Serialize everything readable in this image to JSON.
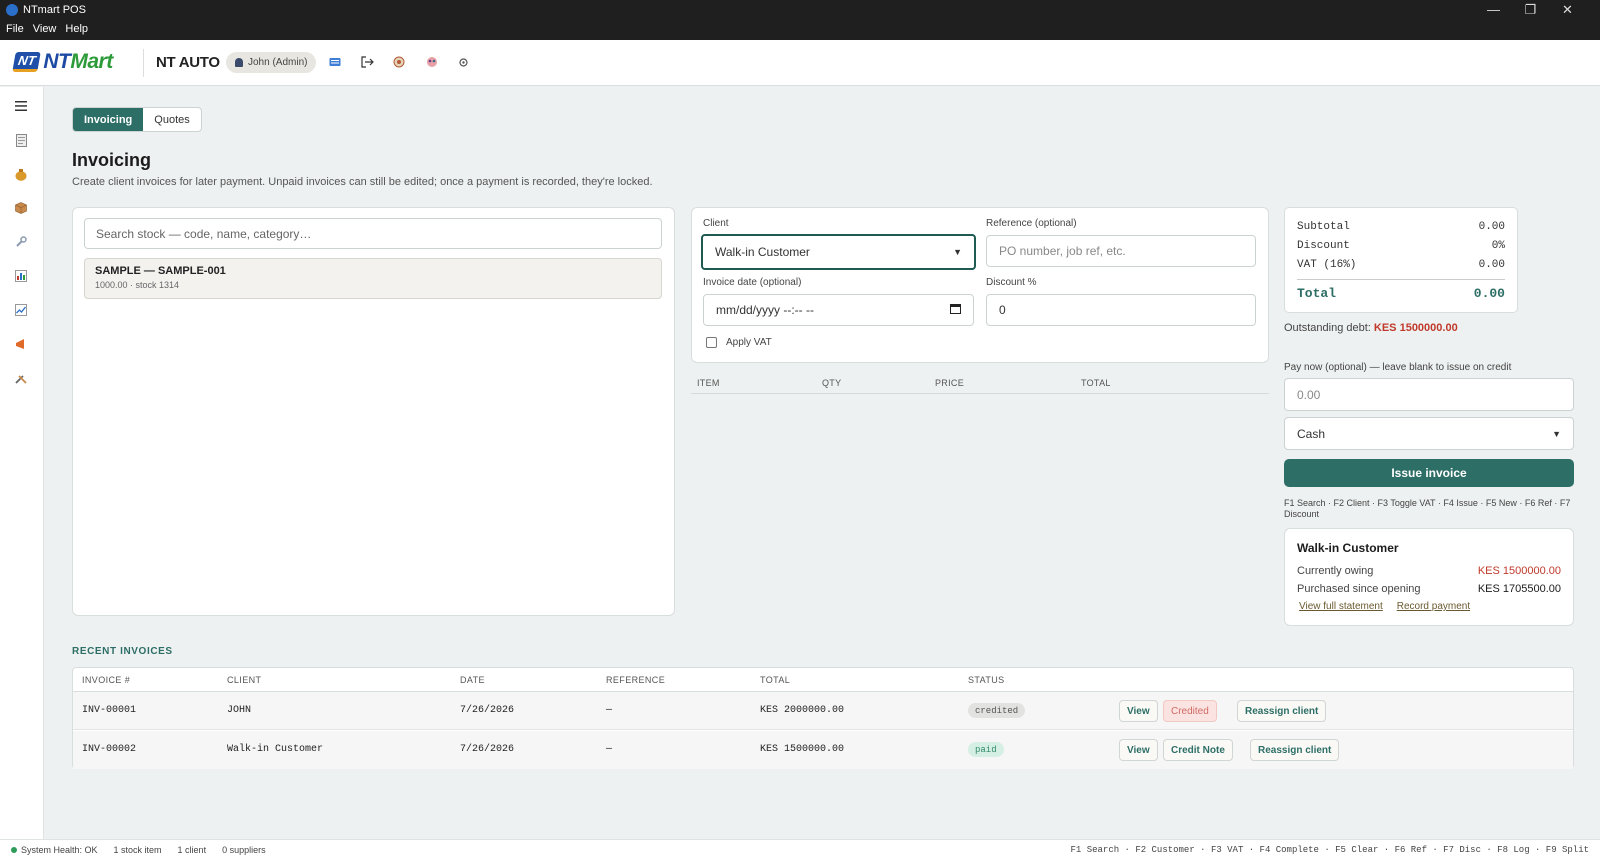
{
  "window": {
    "title": "NTmart POS",
    "menu": [
      "File",
      "View",
      "Help"
    ],
    "controls": [
      "—",
      "❐",
      "✕"
    ]
  },
  "topbar": {
    "logo_mark": "NT",
    "logo_word_a": "NT",
    "logo_word_b": "Mart",
    "brand": "NT AUTO",
    "user": "John (Admin)"
  },
  "tabs": [
    {
      "label": "Invoicing",
      "active": true
    },
    {
      "label": "Quotes",
      "active": false
    }
  ],
  "page": {
    "title": "Invoicing",
    "subtitle": "Create client invoices for later payment. Unpaid invoices can still be edited; once a payment is recorded, they're locked."
  },
  "stock": {
    "search_placeholder": "Search stock — code, name, category…",
    "items": [
      {
        "name": "SAMPLE — SAMPLE-001",
        "meta": "1000.00 · stock 1314"
      }
    ]
  },
  "form": {
    "client_label": "Client",
    "client_value": "Walk-in Customer",
    "reference_label": "Reference (optional)",
    "reference_placeholder": "PO number, job ref, etc.",
    "date_label": "Invoice date (optional)",
    "date_placeholder": "mm/dd/yyyy --:-- --",
    "discount_label": "Discount %",
    "discount_value": "0",
    "vat_label": "Apply VAT"
  },
  "items_table": {
    "headers": [
      "ITEM",
      "QTY",
      "PRICE",
      "TOTAL"
    ]
  },
  "totals": {
    "subtotal_label": "Subtotal",
    "subtotal": "0.00",
    "discount_label": "Discount",
    "discount": "0%",
    "vat_label": "VAT (16%)",
    "vat": "0.00",
    "total_label": "Total",
    "total": "0.00"
  },
  "debt": {
    "label": "Outstanding debt:",
    "value": "KES 1500000.00"
  },
  "payment": {
    "label": "Pay now (optional) — leave blank to issue on credit",
    "amount_placeholder": "0.00",
    "method": "Cash",
    "issue_button": "Issue invoice",
    "shortcuts": "F1 Search · F2 Client · F3 Toggle VAT · F4 Issue · F5 New · F6 Ref · F7 Discount"
  },
  "client_card": {
    "name": "Walk-in Customer",
    "owing_label": "Currently owing",
    "owing": "KES 1500000.00",
    "purchased_label": "Purchased since opening",
    "purchased": "KES 1705500.00",
    "link_statement": "View full statement",
    "link_payment": "Record payment"
  },
  "recent": {
    "title": "RECENT INVOICES",
    "headers": [
      "INVOICE #",
      "CLIENT",
      "DATE",
      "REFERENCE",
      "TOTAL",
      "STATUS"
    ],
    "rows": [
      {
        "invoice": "INV-00001",
        "client": "JOHN",
        "date": "7/26/2026",
        "reference": "—",
        "total": "KES 2000000.00",
        "status": "credited",
        "actions": [
          "View",
          "Credited",
          "Reassign client"
        ]
      },
      {
        "invoice": "INV-00002",
        "client": "Walk-in Customer",
        "date": "7/26/2026",
        "reference": "—",
        "total": "KES 1500000.00",
        "status": "paid",
        "actions": [
          "View",
          "Credit Note",
          "Reassign client"
        ]
      }
    ]
  },
  "statusbar": {
    "health": "System Health: OK",
    "stock": "1 stock item",
    "clients": "1 client",
    "suppliers": "0 suppliers",
    "shortcuts": "F1 Search · F2 Customer · F3 VAT · F4 Complete · F5 Clear · F6 Ref · F7 Disc · F8 Log · F9 Split"
  },
  "colors": {
    "accent": "#2d6e66",
    "danger": "#c0392b",
    "paid": "#2d8a66"
  }
}
